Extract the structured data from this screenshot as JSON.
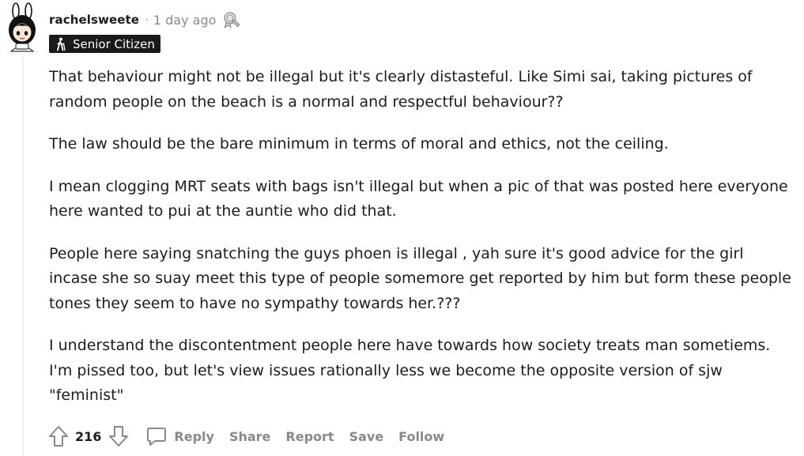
{
  "comment": {
    "username": "rachelsweete",
    "separator": "·",
    "timestamp": "1 day ago",
    "award_icon": "silver-award-icon",
    "flair": {
      "icon": "walking-person-icon",
      "label": "Senior Citizen"
    },
    "paragraphs": [
      "That behaviour might not be illegal but it's clearly distasteful. Like Simi sai, taking pictures of random people on the beach is a normal and respectful behaviour??",
      "The law should be the bare minimum in terms of moral and ethics, not the ceiling.",
      "I mean clogging MRT seats with bags isn't illegal but when a pic of that was posted here everyone here wanted to pui at the auntie who did that.",
      "People here saying snatching the guys phoen is illegal , yah sure it's good advice for the girl incase she so suay meet this type of people somemore get reported by him but form these people tones they seem to have no sympathy towards her.???",
      "I understand the discontentment people here have towards how society treats man sometiems. I'm pissed too, but let's view issues rationally less we become the opposite version of sjw \"feminist\""
    ],
    "score": "216",
    "actions": {
      "reply": "Reply",
      "share": "Share",
      "report": "Report",
      "save": "Save",
      "follow": "Follow"
    }
  },
  "colors": {
    "text": "#1c1c1c",
    "meta": "#878a8c",
    "flair_bg": "#1a1a1b",
    "thread_line": "#edeff1"
  }
}
